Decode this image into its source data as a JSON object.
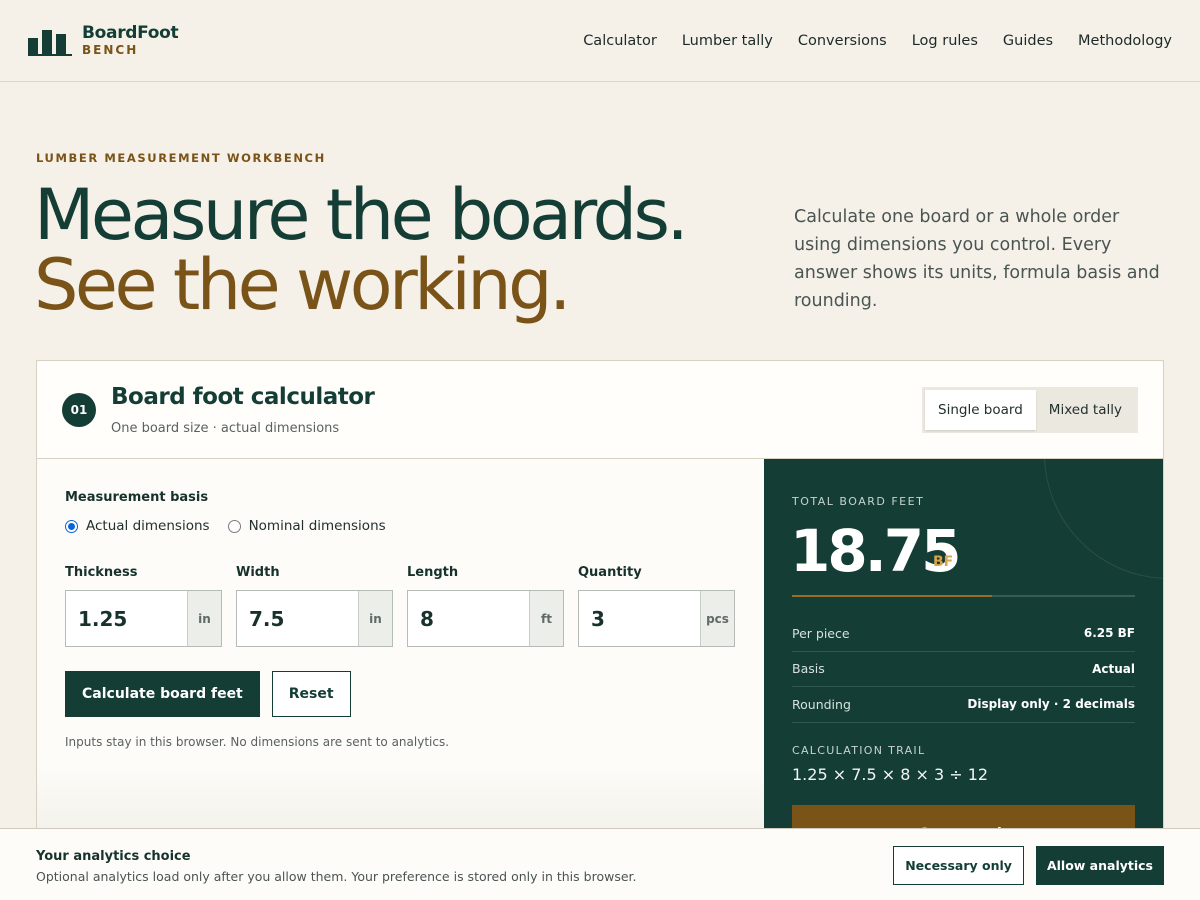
{
  "brand": {
    "name": "BoardFoot",
    "sub": "BENCH",
    "logo_icon": "bar-chart-logo-icon"
  },
  "nav": {
    "items": [
      {
        "label": "Calculator"
      },
      {
        "label": "Lumber tally"
      },
      {
        "label": "Conversions"
      },
      {
        "label": "Log rules"
      },
      {
        "label": "Guides"
      },
      {
        "label": "Methodology"
      }
    ]
  },
  "hero": {
    "eyebrow": "LUMBER MEASUREMENT WORKBENCH",
    "title_line1": "Measure the boards.",
    "title_line2": "See the working.",
    "description": "Calculate one board or a whole order using dimensions you control. Every answer shows its units, formula basis and rounding."
  },
  "calculator": {
    "step": "01",
    "title": "Board foot calculator",
    "subtitle": "One board size · actual dimensions",
    "modes": [
      {
        "label": "Single board",
        "active": true
      },
      {
        "label": "Mixed tally",
        "active": false
      }
    ],
    "basis": {
      "label": "Measurement basis",
      "options": [
        {
          "label": "Actual dimensions",
          "checked": true
        },
        {
          "label": "Nominal dimensions",
          "checked": false
        }
      ]
    },
    "fields": [
      {
        "label": "Thickness",
        "value": "1.25",
        "unit": "in"
      },
      {
        "label": "Width",
        "value": "7.5",
        "unit": "in"
      },
      {
        "label": "Length",
        "value": "8",
        "unit": "ft"
      },
      {
        "label": "Quantity",
        "value": "3",
        "unit": "pcs"
      }
    ],
    "calculate_label": "Calculate board feet",
    "reset_label": "Reset",
    "privacy_note": "Inputs stay in this browser. No dimensions are sent to analytics."
  },
  "result": {
    "label": "TOTAL BOARD FEET",
    "value": "18.75",
    "unit": "BF",
    "stats": [
      {
        "key": "Per piece",
        "value": "6.25 BF"
      },
      {
        "key": "Basis",
        "value": "Actual"
      },
      {
        "key": "Rounding",
        "value": "Display only · 2 decimals"
      }
    ],
    "trail_label": "CALCULATION TRAIL",
    "trail": "1.25 × 7.5 × 8 × 3 ÷ 12",
    "copy_label": "Copy result"
  },
  "cookie": {
    "title": "Your analytics choice",
    "text": "Optional analytics load only after you allow them. Your preference is stored only in this browser.",
    "necessary_label": "Necessary only",
    "allow_label": "Allow analytics"
  },
  "colors": {
    "primary": "#143d36",
    "accent": "#7a5318",
    "background": "#f5f1e8",
    "result_unit": "#d9a548"
  }
}
